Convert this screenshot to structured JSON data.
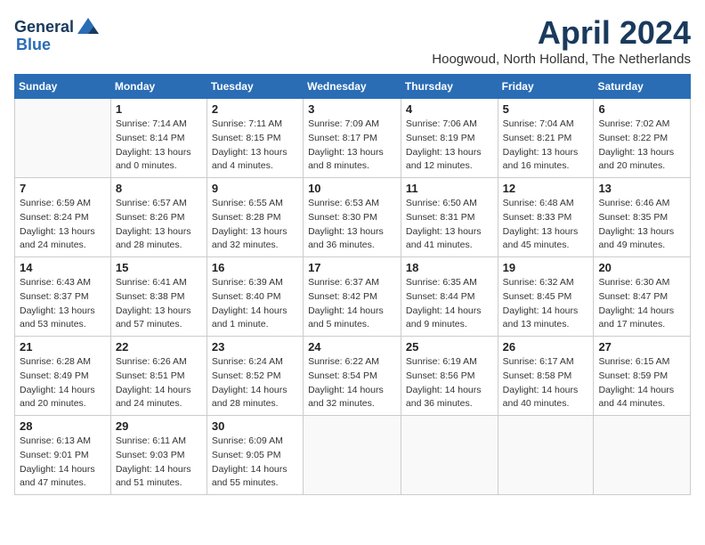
{
  "header": {
    "logo_general": "General",
    "logo_blue": "Blue",
    "month_title": "April 2024",
    "location": "Hoogwoud, North Holland, The Netherlands"
  },
  "weekdays": [
    "Sunday",
    "Monday",
    "Tuesday",
    "Wednesday",
    "Thursday",
    "Friday",
    "Saturday"
  ],
  "weeks": [
    [
      {
        "day": "",
        "info": ""
      },
      {
        "day": "1",
        "info": "Sunrise: 7:14 AM\nSunset: 8:14 PM\nDaylight: 13 hours\nand 0 minutes."
      },
      {
        "day": "2",
        "info": "Sunrise: 7:11 AM\nSunset: 8:15 PM\nDaylight: 13 hours\nand 4 minutes."
      },
      {
        "day": "3",
        "info": "Sunrise: 7:09 AM\nSunset: 8:17 PM\nDaylight: 13 hours\nand 8 minutes."
      },
      {
        "day": "4",
        "info": "Sunrise: 7:06 AM\nSunset: 8:19 PM\nDaylight: 13 hours\nand 12 minutes."
      },
      {
        "day": "5",
        "info": "Sunrise: 7:04 AM\nSunset: 8:21 PM\nDaylight: 13 hours\nand 16 minutes."
      },
      {
        "day": "6",
        "info": "Sunrise: 7:02 AM\nSunset: 8:22 PM\nDaylight: 13 hours\nand 20 minutes."
      }
    ],
    [
      {
        "day": "7",
        "info": "Sunrise: 6:59 AM\nSunset: 8:24 PM\nDaylight: 13 hours\nand 24 minutes."
      },
      {
        "day": "8",
        "info": "Sunrise: 6:57 AM\nSunset: 8:26 PM\nDaylight: 13 hours\nand 28 minutes."
      },
      {
        "day": "9",
        "info": "Sunrise: 6:55 AM\nSunset: 8:28 PM\nDaylight: 13 hours\nand 32 minutes."
      },
      {
        "day": "10",
        "info": "Sunrise: 6:53 AM\nSunset: 8:30 PM\nDaylight: 13 hours\nand 36 minutes."
      },
      {
        "day": "11",
        "info": "Sunrise: 6:50 AM\nSunset: 8:31 PM\nDaylight: 13 hours\nand 41 minutes."
      },
      {
        "day": "12",
        "info": "Sunrise: 6:48 AM\nSunset: 8:33 PM\nDaylight: 13 hours\nand 45 minutes."
      },
      {
        "day": "13",
        "info": "Sunrise: 6:46 AM\nSunset: 8:35 PM\nDaylight: 13 hours\nand 49 minutes."
      }
    ],
    [
      {
        "day": "14",
        "info": "Sunrise: 6:43 AM\nSunset: 8:37 PM\nDaylight: 13 hours\nand 53 minutes."
      },
      {
        "day": "15",
        "info": "Sunrise: 6:41 AM\nSunset: 8:38 PM\nDaylight: 13 hours\nand 57 minutes."
      },
      {
        "day": "16",
        "info": "Sunrise: 6:39 AM\nSunset: 8:40 PM\nDaylight: 14 hours\nand 1 minute."
      },
      {
        "day": "17",
        "info": "Sunrise: 6:37 AM\nSunset: 8:42 PM\nDaylight: 14 hours\nand 5 minutes."
      },
      {
        "day": "18",
        "info": "Sunrise: 6:35 AM\nSunset: 8:44 PM\nDaylight: 14 hours\nand 9 minutes."
      },
      {
        "day": "19",
        "info": "Sunrise: 6:32 AM\nSunset: 8:45 PM\nDaylight: 14 hours\nand 13 minutes."
      },
      {
        "day": "20",
        "info": "Sunrise: 6:30 AM\nSunset: 8:47 PM\nDaylight: 14 hours\nand 17 minutes."
      }
    ],
    [
      {
        "day": "21",
        "info": "Sunrise: 6:28 AM\nSunset: 8:49 PM\nDaylight: 14 hours\nand 20 minutes."
      },
      {
        "day": "22",
        "info": "Sunrise: 6:26 AM\nSunset: 8:51 PM\nDaylight: 14 hours\nand 24 minutes."
      },
      {
        "day": "23",
        "info": "Sunrise: 6:24 AM\nSunset: 8:52 PM\nDaylight: 14 hours\nand 28 minutes."
      },
      {
        "day": "24",
        "info": "Sunrise: 6:22 AM\nSunset: 8:54 PM\nDaylight: 14 hours\nand 32 minutes."
      },
      {
        "day": "25",
        "info": "Sunrise: 6:19 AM\nSunset: 8:56 PM\nDaylight: 14 hours\nand 36 minutes."
      },
      {
        "day": "26",
        "info": "Sunrise: 6:17 AM\nSunset: 8:58 PM\nDaylight: 14 hours\nand 40 minutes."
      },
      {
        "day": "27",
        "info": "Sunrise: 6:15 AM\nSunset: 8:59 PM\nDaylight: 14 hours\nand 44 minutes."
      }
    ],
    [
      {
        "day": "28",
        "info": "Sunrise: 6:13 AM\nSunset: 9:01 PM\nDaylight: 14 hours\nand 47 minutes."
      },
      {
        "day": "29",
        "info": "Sunrise: 6:11 AM\nSunset: 9:03 PM\nDaylight: 14 hours\nand 51 minutes."
      },
      {
        "day": "30",
        "info": "Sunrise: 6:09 AM\nSunset: 9:05 PM\nDaylight: 14 hours\nand 55 minutes."
      },
      {
        "day": "",
        "info": ""
      },
      {
        "day": "",
        "info": ""
      },
      {
        "day": "",
        "info": ""
      },
      {
        "day": "",
        "info": ""
      }
    ]
  ]
}
